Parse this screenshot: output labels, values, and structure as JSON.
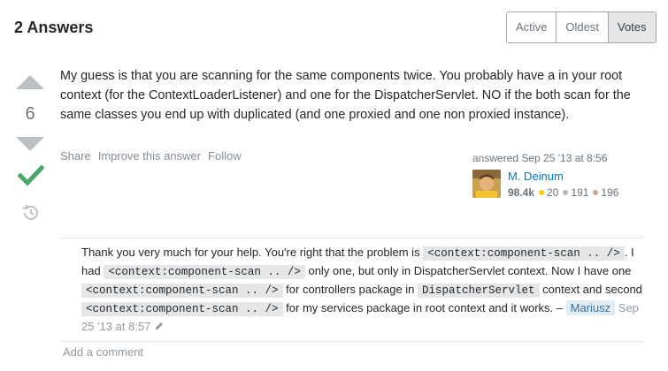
{
  "header": {
    "answers_count": "2 Answers",
    "tabs": [
      {
        "label": "Active",
        "active": false
      },
      {
        "label": "Oldest",
        "active": false
      },
      {
        "label": "Votes",
        "active": true
      }
    ]
  },
  "answer": {
    "vote_count": "6",
    "accepted": true,
    "body": "My guess is that you are scanning for the same components twice. You probably have a in your root context (for the ContextLoaderListener) and one for the DispatcherServlet. NO if the both scan for the same classes you end up with duplicated (and one proxied and one non proxied instance).",
    "menu": {
      "share": "Share",
      "improve": "Improve this answer",
      "follow": "Follow"
    },
    "signature": {
      "action": "answered",
      "time": "Sep 25 '13 at 8:56",
      "user_name": "M. Deinum",
      "reputation": "98.4k",
      "gold_badges": "20",
      "silver_badges": "191",
      "bronze_badges": "196"
    }
  },
  "comment": {
    "t1": "Thank you very much for your help. You're right that the problem is ",
    "c1": "<context:component-scan .. />",
    "t2": ". I had ",
    "c2": "<context:component-scan .. />",
    "t3": " only one, but only in DispatcherServlet context. Now I have one ",
    "c3": "<context:component-scan .. />",
    "t4": " for controllers package in ",
    "c4": "DispatcherServlet",
    "t5": " context and second ",
    "c5": "<context:component-scan .. />",
    "t6": " for my services package in root context and it works. – ",
    "user": "Mariusz",
    "date": "Sep 25 '13 at 8:57"
  },
  "add_comment": "Add a comment",
  "colors": {
    "accent_link": "#0077cc",
    "accepted_green": "#48a868",
    "gold": "#ffcc01",
    "silver": "#b4b8bc",
    "bronze": "#d1a684"
  },
  "icons": {
    "vote_up": "arrow-up-icon",
    "vote_down": "arrow-down-icon",
    "accepted": "checkmark-icon",
    "history": "history-icon",
    "edit": "pencil-icon"
  }
}
